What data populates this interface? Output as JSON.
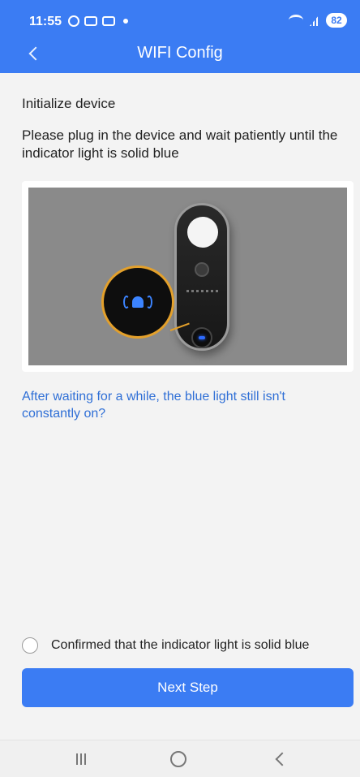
{
  "status_bar": {
    "time": "11:55",
    "battery": "82",
    "icons": [
      "screenshot-icon",
      "notification-icon",
      "teams-icon",
      "dot-icon",
      "wifi-icon",
      "signal-icon",
      "battery-icon"
    ]
  },
  "app_bar": {
    "title": "WIFI Config",
    "back_icon": "chevron-left-icon"
  },
  "content": {
    "heading": "Initialize device",
    "instruction": "Please plug in the device and wait patiently until the indicator light is solid blue",
    "illustration": "doorbell-device-illustration",
    "help_link": "After waiting for a while, the blue light still isn't constantly on?"
  },
  "confirm": {
    "label": "Confirmed that the indicator light is solid blue",
    "checked": false
  },
  "next_button": {
    "label": "Next Step"
  },
  "colors": {
    "primary": "#3b7cf3",
    "link": "#2f6fd6",
    "background": "#f3f3f3"
  },
  "system_nav": {
    "icons": [
      "recent-apps-icon",
      "home-icon",
      "back-icon"
    ]
  }
}
